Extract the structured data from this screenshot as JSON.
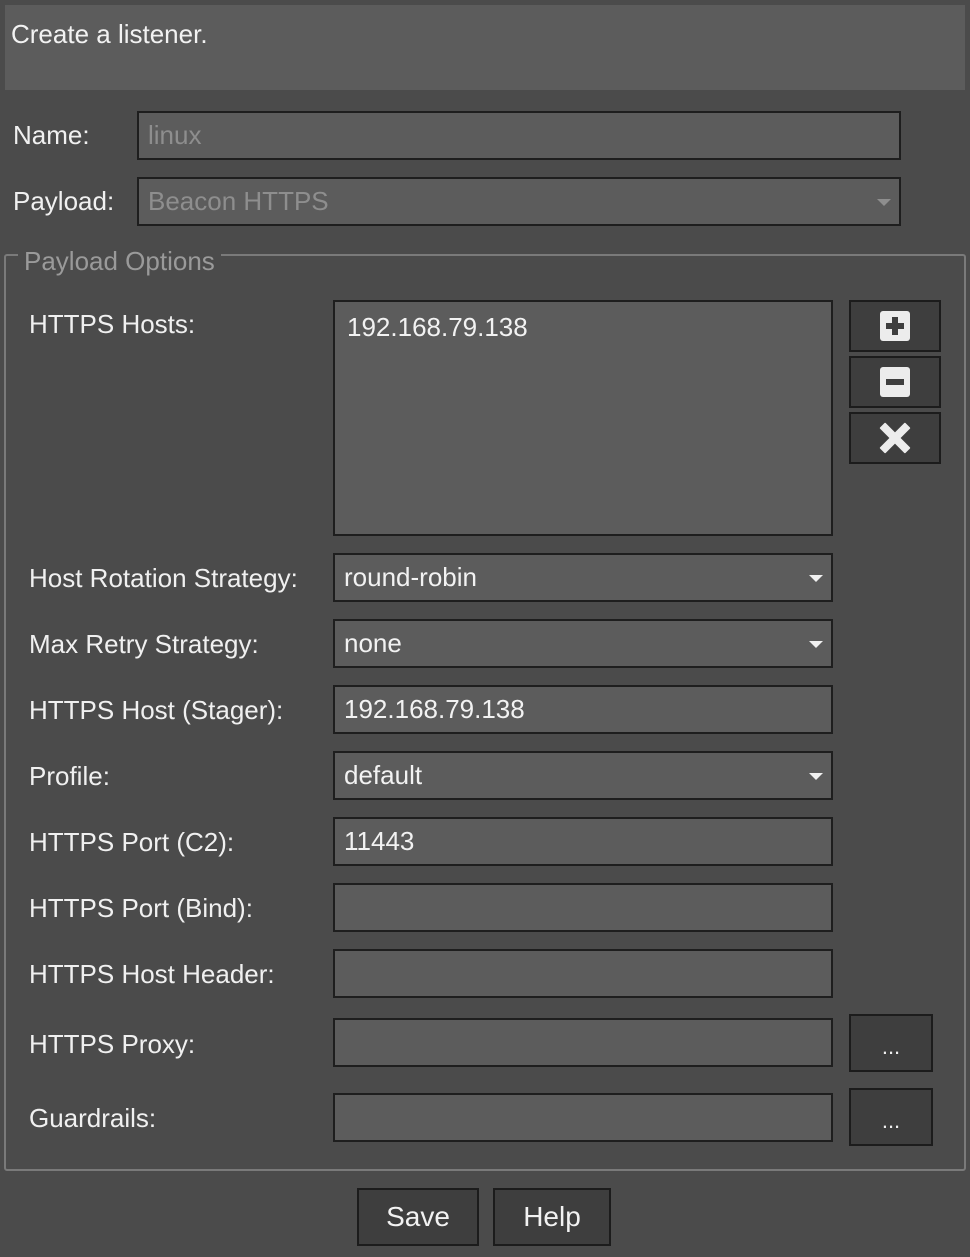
{
  "header": {
    "title": "Create a listener."
  },
  "form": {
    "name_label": "Name:",
    "name_value": "linux",
    "payload_label": "Payload:",
    "payload_value": "Beacon HTTPS"
  },
  "payload_options": {
    "legend": "Payload Options",
    "https_hosts_label": "HTTPS Hosts:",
    "https_hosts": [
      "192.168.79.138"
    ],
    "add_icon": "plus-icon",
    "remove_icon": "minus-icon",
    "clear_icon": "close-icon",
    "host_rotation_label": "Host Rotation Strategy:",
    "host_rotation_value": "round-robin",
    "max_retry_label": "Max Retry Strategy:",
    "max_retry_value": "none",
    "stager_host_label": "HTTPS Host (Stager):",
    "stager_host_value": "192.168.79.138",
    "profile_label": "Profile:",
    "profile_value": "default",
    "port_c2_label": "HTTPS Port (C2):",
    "port_c2_value": "11443",
    "port_bind_label": "HTTPS Port (Bind):",
    "port_bind_value": "",
    "host_header_label": "HTTPS Host Header:",
    "host_header_value": "",
    "proxy_label": "HTTPS Proxy:",
    "proxy_value": "",
    "proxy_button": "...",
    "guardrails_label": "Guardrails:",
    "guardrails_value": "",
    "guardrails_button": "..."
  },
  "footer": {
    "save_label": "Save",
    "help_label": "Help"
  }
}
